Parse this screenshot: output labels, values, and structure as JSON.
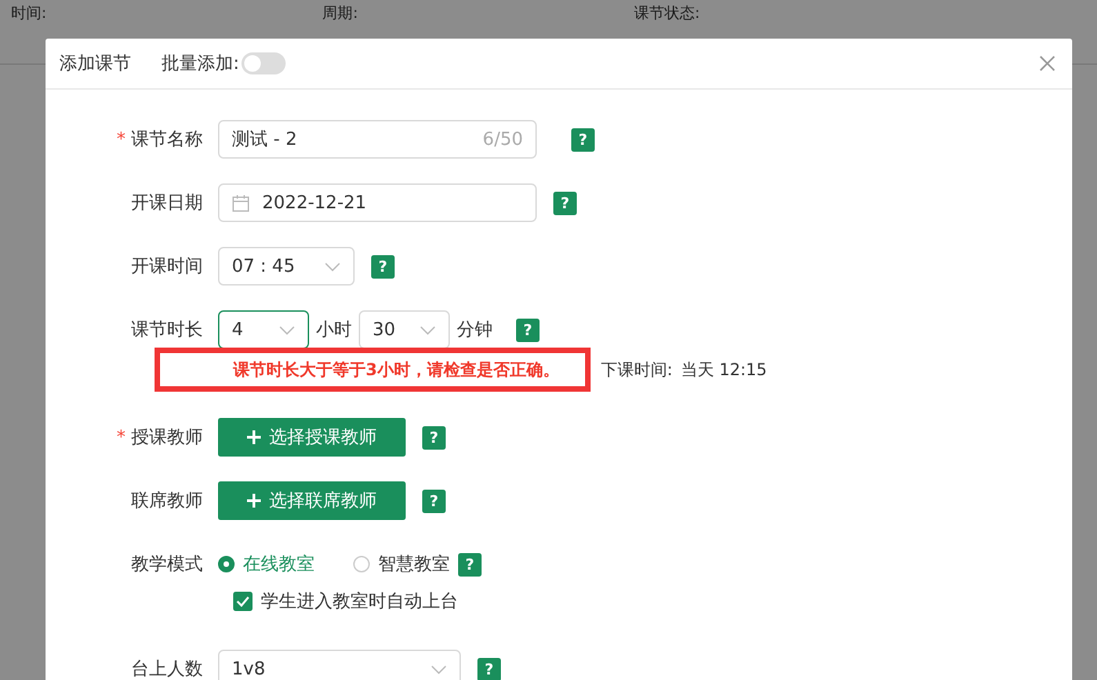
{
  "background_filters": [
    {
      "label": "时间:"
    },
    {
      "label": "周期:"
    },
    {
      "label": "课节状态:"
    }
  ],
  "dialog": {
    "title": "添加课节",
    "batch_label": "批量添加:",
    "batch_on": false
  },
  "form": [
    {
      "kind": "text",
      "label": "课节名称",
      "required_mark": "*",
      "value": "测试 - 2",
      "counter": "6/50",
      "help": "?"
    },
    {
      "kind": "date",
      "label": "开课日期",
      "value": "2022-12-21",
      "help": "?"
    },
    {
      "kind": "select",
      "label": "开课时间",
      "value": "07 : 45",
      "help": "?"
    },
    {
      "kind": "duration",
      "label": "课节时长",
      "hours": "4",
      "hours_focused": true,
      "hours_unit": "小时",
      "minutes": "30",
      "minutes_unit": "分钟",
      "help": "?",
      "warning": "课节时长大于等于3小时，请检查是否正确。",
      "end_label": "下课时间:",
      "end_value": "当天 12:15"
    },
    {
      "kind": "button",
      "label": "授课教师",
      "required_mark": "*",
      "button": "选择授课教师",
      "help": "?"
    },
    {
      "kind": "button",
      "label": "联席教师",
      "button": "选择联席教师",
      "help": "?"
    },
    {
      "kind": "radio",
      "label": "教学模式",
      "options": [
        {
          "label": "在线教室",
          "selected": true
        },
        {
          "label": "智慧教室",
          "selected": false
        }
      ],
      "help": "?",
      "checkbox": {
        "label": "学生进入教室时自动上台",
        "checked": true
      }
    },
    {
      "kind": "wide-select",
      "label": "台上人数",
      "value": "1v8",
      "help": "?"
    }
  ]
}
